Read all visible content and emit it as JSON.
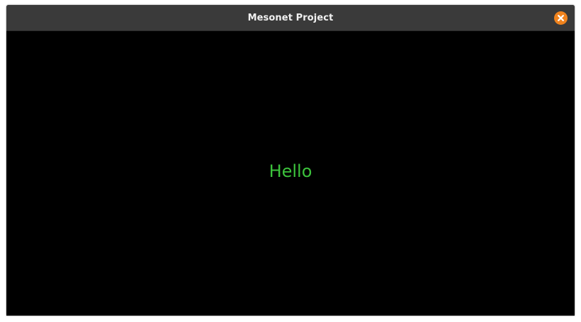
{
  "window": {
    "title": "Mesonet Project",
    "close_icon": "close-icon"
  },
  "content": {
    "text": "Hello",
    "text_color": "#3cc23c"
  },
  "colors": {
    "titlebar": "#3a3a3a",
    "close_button": "#f0831d",
    "content_background": "#000000"
  }
}
